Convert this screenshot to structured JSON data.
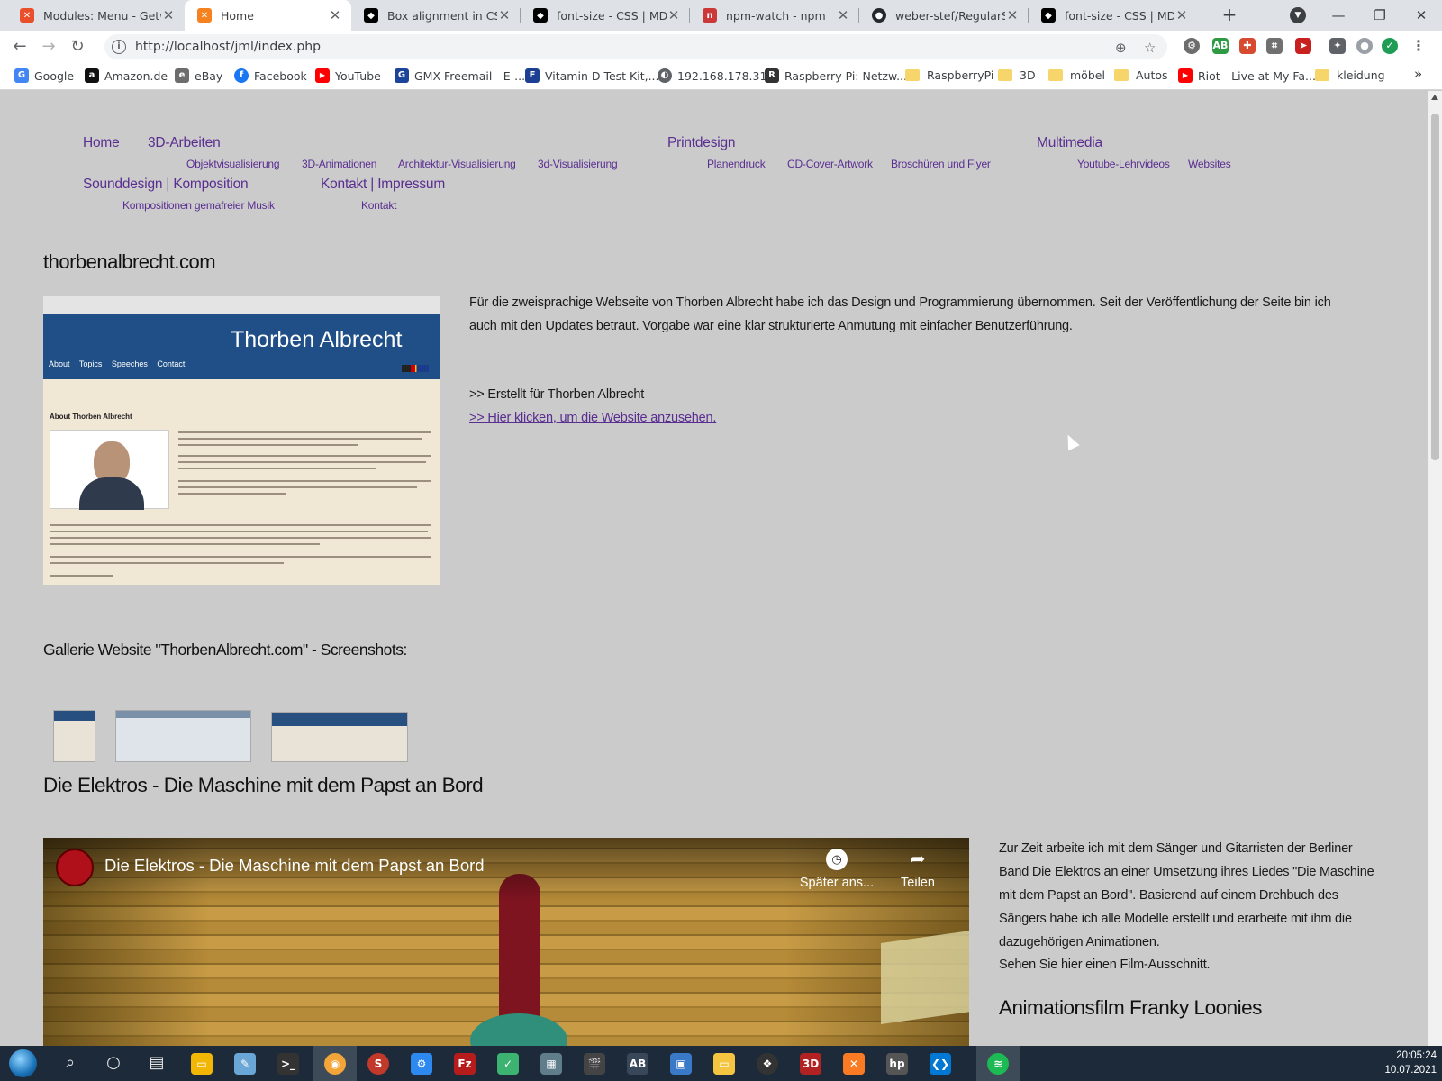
{
  "browser": {
    "tabs": [
      {
        "title": "Modules: Menu - Getwe",
        "favicon": "joomla-favicon",
        "color": "#e94f2a"
      },
      {
        "title": "Home",
        "favicon": "joomla-favicon",
        "color": "#f5821f",
        "active": true
      },
      {
        "title": "Box alignment in CSS G",
        "favicon": "mdn-favicon",
        "color": "#000000"
      },
      {
        "title": "font-size - CSS | MDN",
        "favicon": "mdn-favicon",
        "color": "#000000"
      },
      {
        "title": "npm-watch - npm",
        "favicon": "npm-favicon",
        "color": "#cb3837"
      },
      {
        "title": "weber-stef/RegularSize",
        "favicon": "github-favicon",
        "color": "#24292e"
      },
      {
        "title": "font-size - CSS | MDN",
        "favicon": "mdn-favicon",
        "color": "#000000"
      }
    ],
    "url": "http://localhost/jml/index.php",
    "bookmarks": [
      {
        "label": "Google",
        "icon": "google-icon",
        "color": "#4285f4",
        "glyph": "G"
      },
      {
        "label": "Amazon.de",
        "icon": "amazon-icon",
        "color": "#111111",
        "glyph": "a"
      },
      {
        "label": "eBay",
        "icon": "ebay-icon",
        "color": "#6d6d6d",
        "glyph": "e"
      },
      {
        "label": "Facebook",
        "icon": "facebook-icon",
        "color": "#1877f2",
        "glyph": "f"
      },
      {
        "label": "YouTube",
        "icon": "youtube-icon",
        "color": "#ff0000",
        "glyph": "▶"
      },
      {
        "label": "GMX Freemail - E-...",
        "icon": "gmx-icon",
        "color": "#1c449b",
        "glyph": "G"
      },
      {
        "label": "Vitamin D Test Kit,...",
        "icon": "fi-icon",
        "color": "#1c3f94",
        "glyph": "F"
      },
      {
        "label": "192.168.178.31",
        "icon": "globe-icon",
        "color": "#5f6368",
        "glyph": "◐"
      },
      {
        "label": "Raspberry Pi: Netzw...",
        "icon": "heise-icon",
        "color": "#333333",
        "glyph": "R"
      },
      {
        "label": "RaspberryPi",
        "icon": "folder-icon"
      },
      {
        "label": "3D",
        "icon": "folder-icon"
      },
      {
        "label": "möbel",
        "icon": "folder-icon"
      },
      {
        "label": "Autos",
        "icon": "folder-icon"
      },
      {
        "label": "Riot - Live at My Fa...",
        "icon": "youtube-icon",
        "color": "#ff0000",
        "glyph": "▶"
      },
      {
        "label": "kleidung",
        "icon": "folder-icon"
      }
    ],
    "more_bookmarks": "»"
  },
  "menu": {
    "top": [
      {
        "label": "Home"
      },
      {
        "label": "3D-Arbeiten"
      },
      {
        "label": "Printdesign"
      },
      {
        "label": "Multimedia"
      },
      {
        "label": "Sounddesign | Komposition"
      },
      {
        "label": "Kontakt | Impressum"
      }
    ],
    "sub": [
      {
        "label": "Objektvisualisierung"
      },
      {
        "label": "3D-Animationen"
      },
      {
        "label": "Architektur-Visualisierung"
      },
      {
        "label": "3d-Visualisierung"
      },
      {
        "label": "Planendruck"
      },
      {
        "label": "CD-Cover-Artwork"
      },
      {
        "label": "Broschüren und Flyer"
      },
      {
        "label": "Youtube-Lehrvideos"
      },
      {
        "label": "Websites"
      },
      {
        "label": "Kompositionen gemafreier Musik"
      },
      {
        "label": "Kontakt"
      }
    ]
  },
  "project1": {
    "heading": "thorbenalbrecht.com",
    "screenshot": {
      "site_title": "Thorben Albrecht",
      "nav": "About Topics Speeches Contact",
      "about_heading": "About Thorben Albrecht"
    },
    "description_line1": "Für die zweisprachige Webseite von Thorben Albrecht habe ich das Design und Programmierung übernommen. Seit der Veröffentlichung der Seite bin ich",
    "description_line2": "auch mit den Updates betraut. Vorgabe war eine klar strukturierte Anmutung mit einfacher Benutzerführung.",
    "created_for": ">> Erstellt für Thorben Albrecht",
    "link": ">> Hier klicken, um die Website anzusehen."
  },
  "gallery": {
    "heading": "Gallerie Website \"ThorbenAlbrecht.com\" - Screenshots:"
  },
  "project2": {
    "heading": "Die Elektros - Die Maschine mit dem Papst an Bord",
    "video": {
      "title": "Die Elektros - Die Maschine mit dem Papst an Bord",
      "watch_later": "Später ans...",
      "share": "Teilen"
    },
    "text_lines": [
      "Zur Zeit arbeite ich mit dem Sänger und Gitarristen der Berliner",
      "Band Die Elektros an einer Umsetzung ihres Liedes \"Die Maschine",
      "mit dem Papst an Bord\". Basierend auf einem Drehbuch des",
      "Sängers habe ich alle Modelle erstellt und erarbeite mit ihm die",
      "dazugehörigen Animationen."
    ],
    "excerpt": "Sehen Sie hier einen Film-Ausschnitt.",
    "next_heading": "Animationsfilm Franky Loonies"
  },
  "taskbar": {
    "time": "20:05:24",
    "date": "10.07.2021"
  }
}
